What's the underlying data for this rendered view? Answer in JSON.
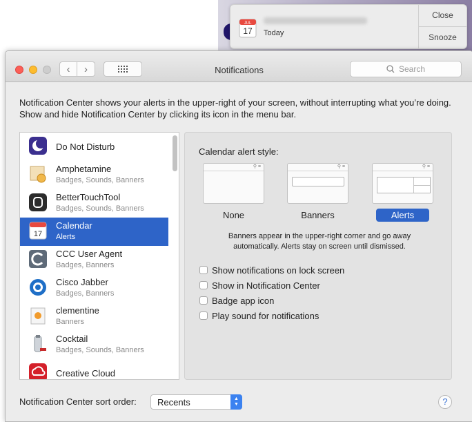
{
  "notification": {
    "subtitle": "Today",
    "close_label": "Close",
    "snooze_label": "Snooze",
    "icon": "calendar-icon",
    "cal_month": "JUL",
    "cal_day": "17"
  },
  "window": {
    "title": "Notifications",
    "search_placeholder": "Search"
  },
  "description": "Notification Center shows your alerts in the upper-right of your screen, without interrupting what you’re doing. Show and hide Notification Center by clicking its icon in the menu bar.",
  "apps": [
    {
      "name": "Do Not Disturb",
      "sub": "",
      "icon": "moon-icon",
      "selected": false
    },
    {
      "name": "Amphetamine",
      "sub": "Badges, Sounds, Banners",
      "icon": "amphetamine-icon",
      "selected": false
    },
    {
      "name": "BetterTouchTool",
      "sub": "Badges, Sounds, Banners",
      "icon": "bettertouchtool-icon",
      "selected": false
    },
    {
      "name": "Calendar",
      "sub": "Alerts",
      "icon": "calendar-icon",
      "selected": true
    },
    {
      "name": "CCC User Agent",
      "sub": "Badges, Banners",
      "icon": "ccc-icon",
      "selected": false
    },
    {
      "name": "Cisco Jabber",
      "sub": "Badges, Banners",
      "icon": "cisco-jabber-icon",
      "selected": false
    },
    {
      "name": "clementine",
      "sub": "Banners",
      "icon": "clementine-icon",
      "selected": false
    },
    {
      "name": "Cocktail",
      "sub": "Badges, Sounds, Banners",
      "icon": "cocktail-icon",
      "selected": false
    },
    {
      "name": "Creative Cloud",
      "sub": "",
      "icon": "creative-cloud-icon",
      "selected": false
    }
  ],
  "panel": {
    "style_label": "Calendar alert style:",
    "options": [
      {
        "label": "None",
        "selected": false
      },
      {
        "label": "Banners",
        "selected": false
      },
      {
        "label": "Alerts",
        "selected": true
      }
    ],
    "hint": "Banners appear in the upper-right corner and go away automatically. Alerts stay on screen until dismissed.",
    "checkboxes": [
      {
        "label": "Show notifications on lock screen",
        "checked": false
      },
      {
        "label": "Show in Notification Center",
        "checked": false
      },
      {
        "label": "Badge app icon",
        "checked": false
      },
      {
        "label": "Play sound for notifications",
        "checked": false
      }
    ]
  },
  "footer": {
    "sort_label": "Notification Center sort order:",
    "sort_value": "Recents",
    "help": "?"
  },
  "colors": {
    "selection": "#2e64c8",
    "window_bg": "#ececec"
  }
}
